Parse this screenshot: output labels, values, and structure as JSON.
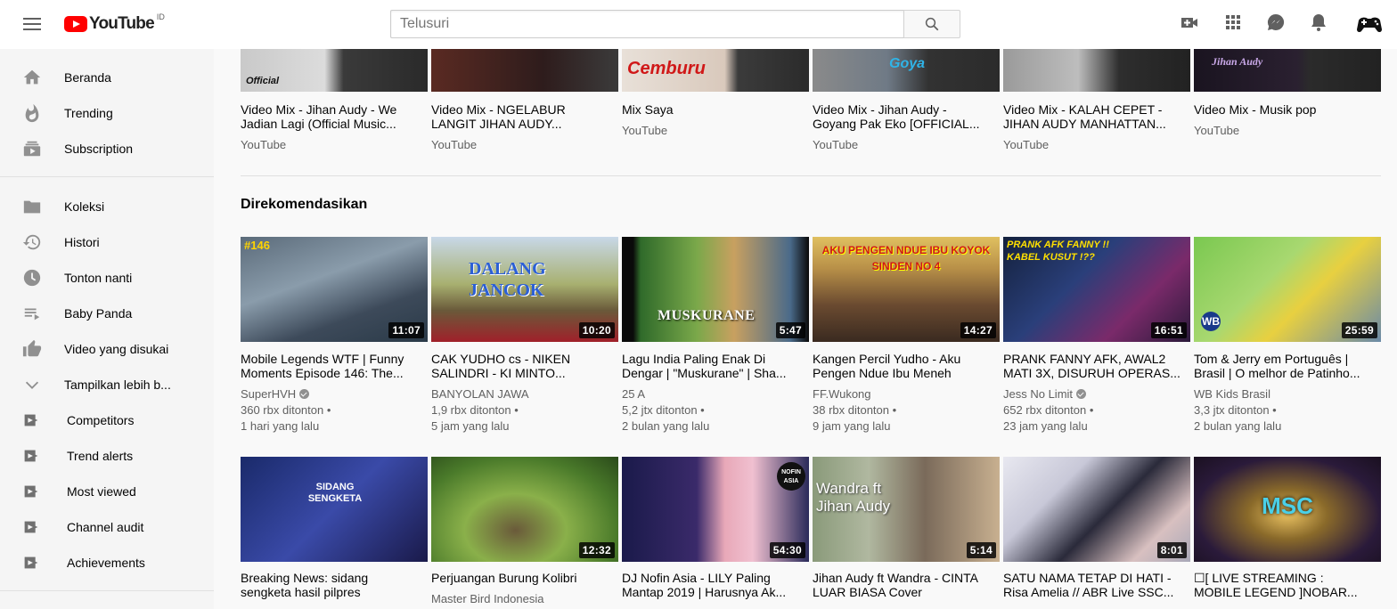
{
  "header": {
    "logo_text": "YouTube",
    "country_code": "ID",
    "search_placeholder": "Telusuri"
  },
  "sidebar": {
    "primary": [
      {
        "label": "Beranda",
        "icon": "home-icon"
      },
      {
        "label": "Trending",
        "icon": "flame-icon"
      },
      {
        "label": "Subscription",
        "icon": "subscriptions-icon"
      }
    ],
    "library": [
      {
        "label": "Koleksi",
        "icon": "folder-icon"
      },
      {
        "label": "Histori",
        "icon": "history-icon"
      },
      {
        "label": "Tonton nanti",
        "icon": "clock-icon"
      },
      {
        "label": "Baby Panda",
        "icon": "playlist-icon"
      },
      {
        "label": "Video yang disukai",
        "icon": "thumbs-up-icon"
      },
      {
        "label": "Tampilkan lebih b...",
        "icon": "chevron-down-icon"
      }
    ],
    "playlists": [
      {
        "label": "Competitors",
        "icon": "playlist-play-icon"
      },
      {
        "label": "Trend alerts",
        "icon": "playlist-play-icon"
      },
      {
        "label": "Most viewed",
        "icon": "playlist-play-icon"
      },
      {
        "label": "Channel audit",
        "icon": "playlist-play-icon"
      },
      {
        "label": "Achievements",
        "icon": "playlist-play-icon"
      }
    ]
  },
  "mixes": [
    {
      "title": "Video Mix - Jihan Audy - We Jadian Lagi (Official Music...",
      "channel": "YouTube",
      "thumb_text": "Official"
    },
    {
      "title": "Video Mix - NGELABUR LANGIT JIHAN AUDY...",
      "channel": "YouTube",
      "thumb_text": ""
    },
    {
      "title": "Mix Saya",
      "channel": "YouTube",
      "thumb_text": "Cemburu"
    },
    {
      "title": "Video Mix - Jihan Audy - Goyang Pak Eko [OFFICIAL...",
      "channel": "YouTube",
      "thumb_text": "Goya"
    },
    {
      "title": "Video Mix - KALAH CEPET - JIHAN AUDY MANHATTAN...",
      "channel": "YouTube",
      "thumb_text": ""
    },
    {
      "title": "Video Mix - Musik pop",
      "channel": "YouTube",
      "thumb_text": "Jihan Audy"
    }
  ],
  "recommended": {
    "section_title": "Direkomendasikan",
    "row1": [
      {
        "title": "Mobile Legends WTF | Funny Moments Episode 146: The...",
        "channel": "SuperHVH",
        "verified": true,
        "views": "360 rbx ditonton",
        "age": "1 hari yang lalu",
        "duration": "11:07",
        "thumb_text": "#146"
      },
      {
        "title": "CAK YUDHO cs - NIKEN SALINDRI - KI MINTO...",
        "channel": "BANYOLAN JAWA",
        "verified": false,
        "views": "1,9 rbx ditonton",
        "age": "5 jam yang lalu",
        "duration": "10:20",
        "thumb_text": "DALANG JANCOK"
      },
      {
        "title": "Lagu India Paling Enak Di Dengar | \"Muskurane\" | Sha...",
        "channel": "25 A",
        "verified": false,
        "views": "5,2 jtx ditonton",
        "age": "2 bulan yang lalu",
        "duration": "5:47",
        "thumb_text": "MUSKURANE"
      },
      {
        "title": "Kangen Percil Yudho - Aku Pengen Ndue Ibu Meneh",
        "channel": "FF.Wukong",
        "verified": false,
        "views": "38 rbx ditonton",
        "age": "9 jam yang lalu",
        "duration": "14:27",
        "thumb_text": "AKU PENGEN NDUE IBU KOYOK SINDEN NO 4"
      },
      {
        "title": "PRANK FANNY AFK, AWAL2 MATI 3X, DISURUH OPERAS...",
        "channel": "Jess No Limit",
        "verified": true,
        "views": "652 rbx ditonton",
        "age": "23 jam yang lalu",
        "duration": "16:51",
        "thumb_text": "PRANK AFK FANNY !! KABEL KUSUT !??"
      },
      {
        "title": "Tom & Jerry em Português | Brasil | O melhor de Patinho...",
        "channel": "WB Kids Brasil",
        "verified": false,
        "views": "3,3 jtx ditonton",
        "age": "2 bulan yang lalu",
        "duration": "25:59",
        "thumb_text": "WB"
      }
    ],
    "row2": [
      {
        "title": "Breaking News: sidang sengketa hasil pilpres",
        "channel": "",
        "duration": "",
        "thumb_text": "SIDANG SENGKETA"
      },
      {
        "title": "Perjuangan Burung Kolibri",
        "channel": "Master Bird Indonesia",
        "duration": "12:32",
        "thumb_text": ""
      },
      {
        "title": "DJ Nofin Asia - LILY Paling Mantap 2019 | Harusnya Ak...",
        "channel": "",
        "duration": "54:30",
        "thumb_text": "NOFIN ASIA"
      },
      {
        "title": "Jihan Audy ft Wandra - CINTA LUAR BIASA Cover",
        "channel": "",
        "duration": "5:14",
        "thumb_text": "Wandra ft Jihan Audy"
      },
      {
        "title": "SATU NAMA TETAP DI HATI - Risa Amelia // ABR Live SSC...",
        "channel": "",
        "duration": "8:01",
        "thumb_text": ""
      },
      {
        "title": "☐[ LIVE STREAMING : MOBILE LEGEND ]NOBAR...",
        "channel": "",
        "duration": "",
        "thumb_text": "MSC"
      }
    ]
  },
  "colors": {
    "brand_red": "#ff0000",
    "sidebar_bg": "#f5f5f5",
    "page_bg": "#f9f9f9",
    "meta_text": "#606060"
  }
}
